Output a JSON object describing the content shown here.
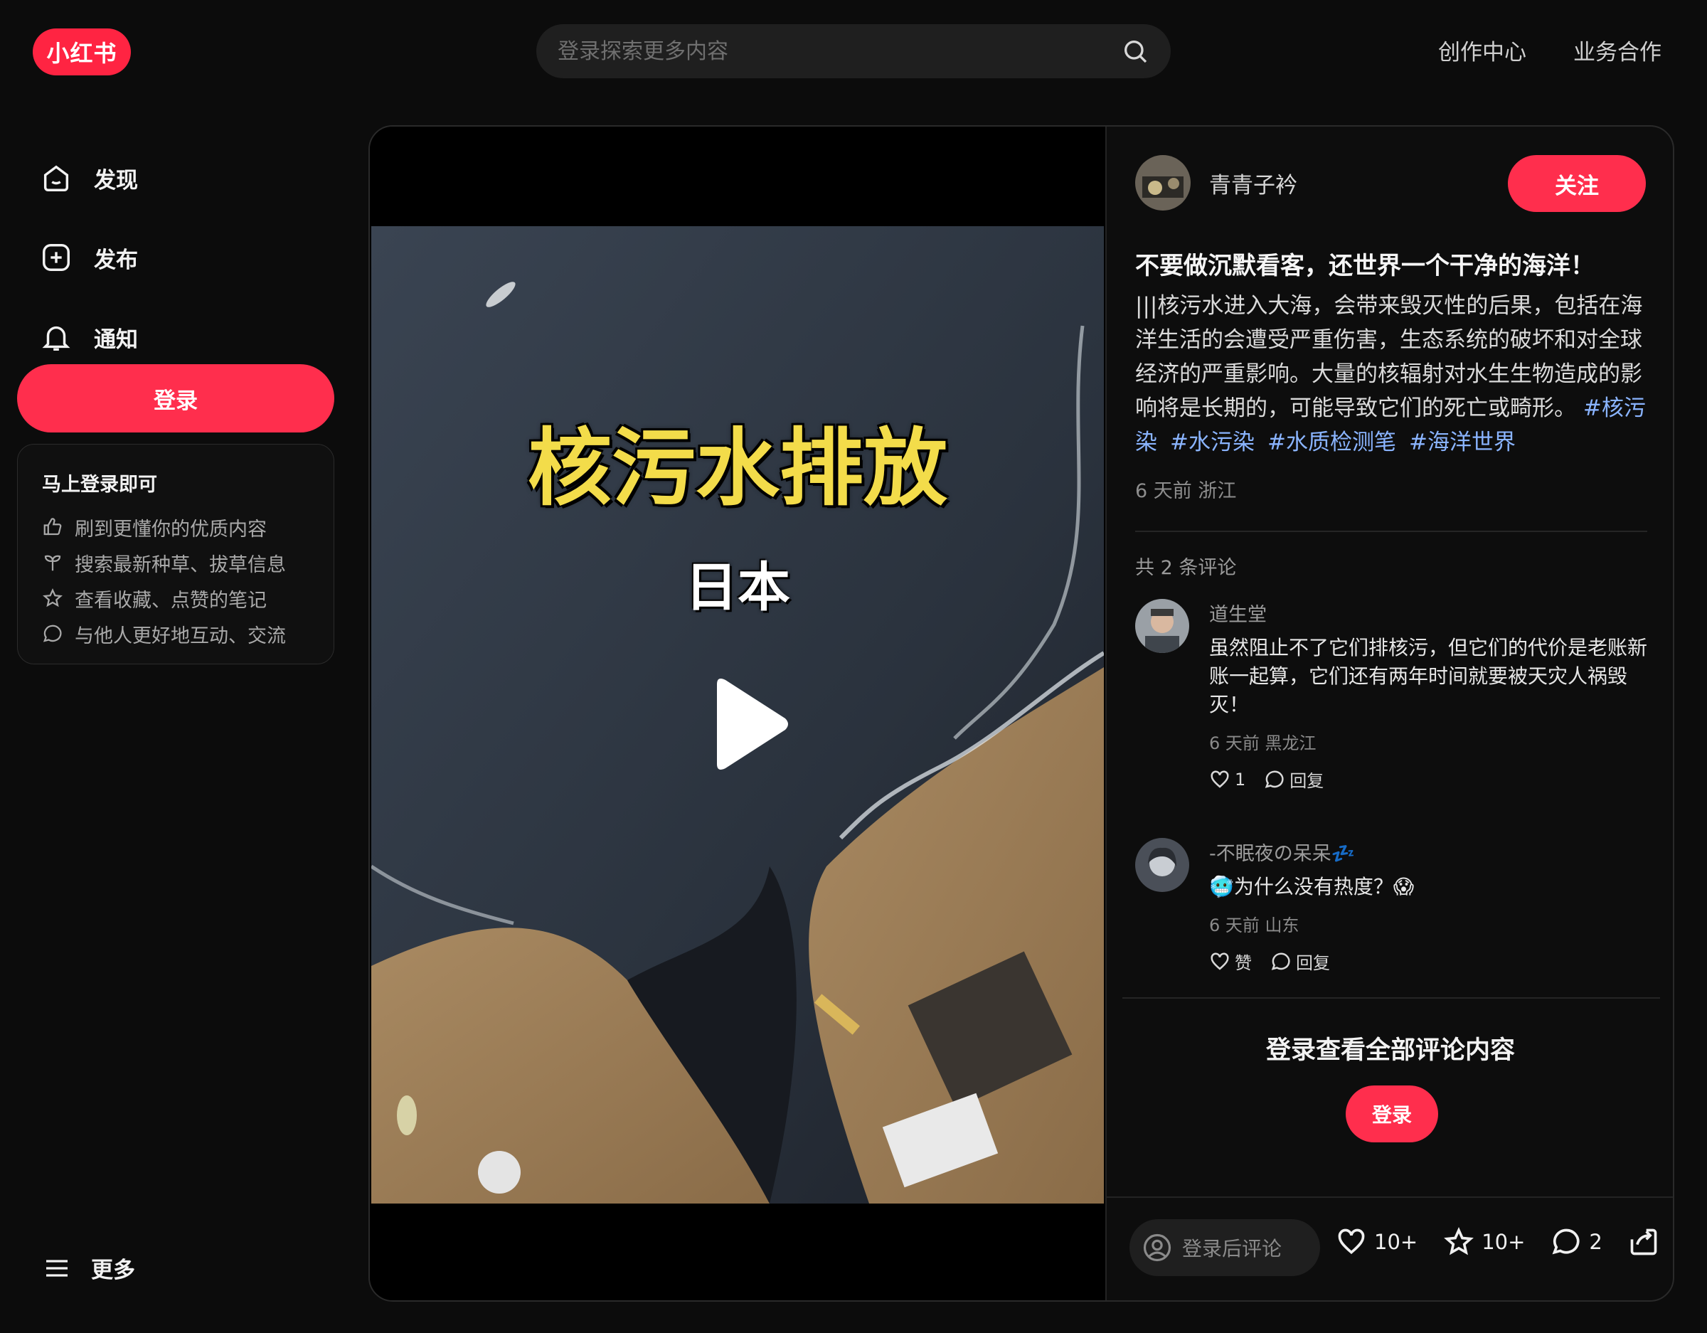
{
  "header": {
    "logo_text": "小红书",
    "search_placeholder": "登录探索更多内容",
    "links": [
      "创作中心",
      "业务合作"
    ]
  },
  "sidebar": {
    "nav": [
      {
        "label": "发现",
        "icon": "discover-icon"
      },
      {
        "label": "发布",
        "icon": "publish-icon"
      },
      {
        "label": "通知",
        "icon": "bell-icon"
      }
    ],
    "login_label": "登录",
    "promo": {
      "title": "马上登录即可",
      "items": [
        {
          "text": "刷到更懂你的优质内容",
          "icon": "thumb-up-icon"
        },
        {
          "text": "搜索最新种草、拔草信息",
          "icon": "sprout-icon"
        },
        {
          "text": "查看收藏、点赞的笔记",
          "icon": "star-icon"
        },
        {
          "text": "与他人更好地互动、交流",
          "icon": "chat-icon"
        }
      ]
    },
    "more_label": "更多"
  },
  "video": {
    "caption_main": "核污水排放",
    "caption_sub": "日本"
  },
  "note": {
    "author": "青青子衿",
    "follow_label": "关注",
    "title": "不要做沉默看客，还世界一个干净的海洋！",
    "description": "|||核污水进入大海，会带来毁灭性的后果，包括在海洋生活的会遭受严重伤害，生态系统的破坏和对全球经济的严重影响。大量的核辐射对水生生物造成的影响将是长期的，可能导致它们的死亡或畸形。",
    "tags": [
      "#核污染",
      "#水污染",
      "#水质检测笔",
      "#海洋世界"
    ],
    "meta": "6 天前 浙江",
    "comment_count": "共 2 条评论"
  },
  "comments": [
    {
      "user": "道生堂",
      "text": "虽然阻止不了它们排核污，但它们的代价是老账新账一起算，它们还有两年时间就要被天灾人祸毁灭！",
      "meta": "6 天前 黑龙江",
      "likes": "1",
      "reply_label": "回复"
    },
    {
      "user": "-不眠夜の呆呆💤",
      "text": "🥶为什么没有热度？😱",
      "meta": "6 天前 山东",
      "likes": "赞",
      "reply_label": "回复"
    }
  ],
  "footer": {
    "login_hint": "登录查看全部评论内容",
    "login_label": "登录",
    "comment_placeholder": "登录后评论",
    "likes": "10+",
    "collects": "10+",
    "comments": "2"
  },
  "colors": {
    "accent": "#ff2e4d",
    "background": "#0c0c0c",
    "caption_yellow": "#f3dc4a",
    "tag_blue": "#8ab4ff"
  }
}
